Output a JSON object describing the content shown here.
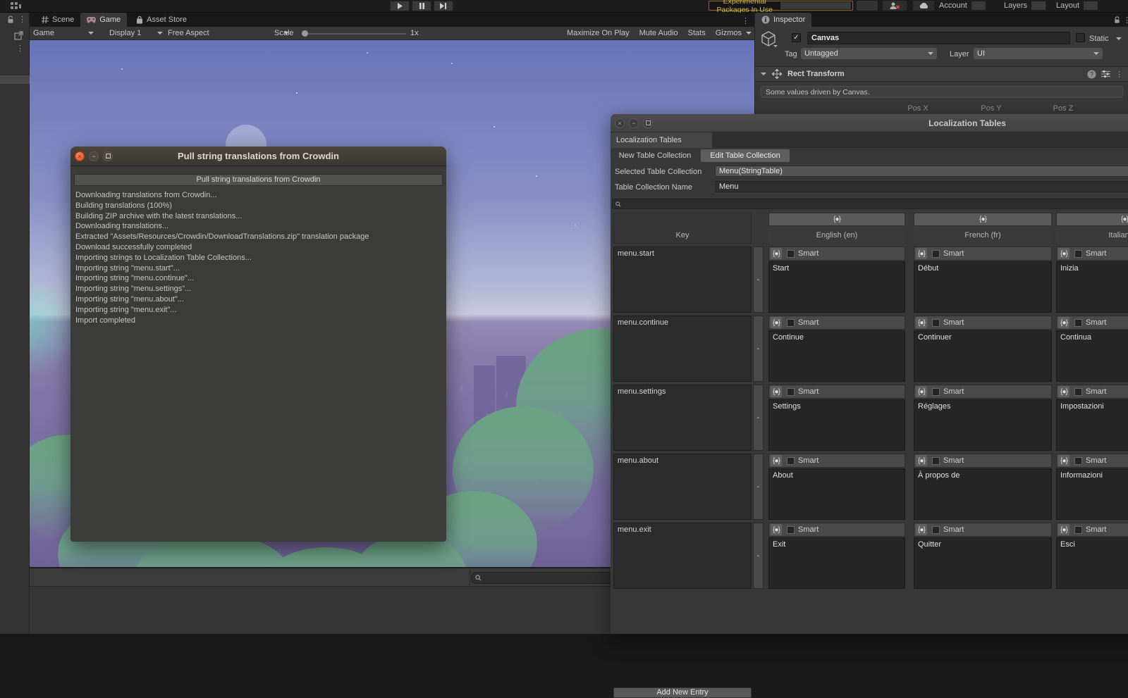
{
  "top_toolbar": {
    "experimental_warning": "Experimental Packages In Use",
    "account_label": "Account",
    "layers_label": "Layers",
    "layout_label": "Layout"
  },
  "game_panel": {
    "tabs": {
      "scene": "Scene",
      "game": "Game",
      "asset_store": "Asset Store"
    },
    "toolbar": {
      "target": "Game",
      "display": "Display 1",
      "aspect": "Free Aspect",
      "scale_label": "Scale",
      "scale_value": "1x",
      "maximize": "Maximize On Play",
      "mute": "Mute Audio",
      "stats": "Stats",
      "gizmos": "Gizmos"
    }
  },
  "inspector": {
    "tab_label": "Inspector",
    "object_name": "Canvas",
    "static_label": "Static",
    "tag_label": "Tag",
    "tag_value": "Untagged",
    "layer_label": "Layer",
    "layer_value": "UI",
    "rect_transform": {
      "title": "Rect Transform",
      "notice": "Some values driven by Canvas.",
      "pos_x": "Pos X",
      "pos_y": "Pos Y",
      "pos_z": "Pos Z"
    }
  },
  "crowdin_dialog": {
    "title": "Pull string translations from Crowdin",
    "button_label": "Pull string translations from Crowdin",
    "log": [
      "Downloading translations from Crowdin...",
      "Building translations (100%)",
      "Building ZIP archive with the latest translations...",
      "Downloading translations...",
      "Extracted \"Assets/Resources/Crowdin/DownloadTranslations.zip\" translation package",
      "Download successfully completed",
      "Importing strings to Localization Table Collections...",
      "Importing string \"menu.start\"...",
      "Importing string \"menu.continue\"...",
      "Importing string \"menu.settings\"...",
      "Importing string \"menu.about\"...",
      "Importing string \"menu.exit\"...",
      "Import completed"
    ]
  },
  "loc_window": {
    "title": "Localization Tables",
    "tab": "Localization Tables",
    "new_btn": "New Table Collection",
    "edit_btn": "Edit Table Collection",
    "selected_label": "Selected Table Collection",
    "selected_value": "Menu(StringTable)",
    "name_label": "Table Collection Name",
    "name_value": "Menu",
    "table": {
      "key_header": "Key",
      "smart_label": "Smart",
      "minus": "-",
      "columns": {
        "en": "English (en)",
        "fr": "French (fr)",
        "it": "Italian (it)"
      },
      "rows": [
        {
          "key": "menu.start",
          "en": "Start",
          "fr": "Début",
          "it": "Inizia"
        },
        {
          "key": "menu.continue",
          "en": "Continue",
          "fr": "Continuer",
          "it": "Continua"
        },
        {
          "key": "menu.settings",
          "en": "Settings",
          "fr": "Réglages",
          "it": "Impostazioni"
        },
        {
          "key": "menu.about",
          "en": "About",
          "fr": "À propos de",
          "it": "Informazioni"
        },
        {
          "key": "menu.exit",
          "en": "Exit",
          "fr": "Quitter",
          "it": "Esci"
        }
      ],
      "add_entry": "Add New Entry"
    }
  },
  "colors": {
    "panel": "#383838",
    "dark": "#191919",
    "warning_text": "#d9b44a",
    "close_button": "#e0491f"
  }
}
